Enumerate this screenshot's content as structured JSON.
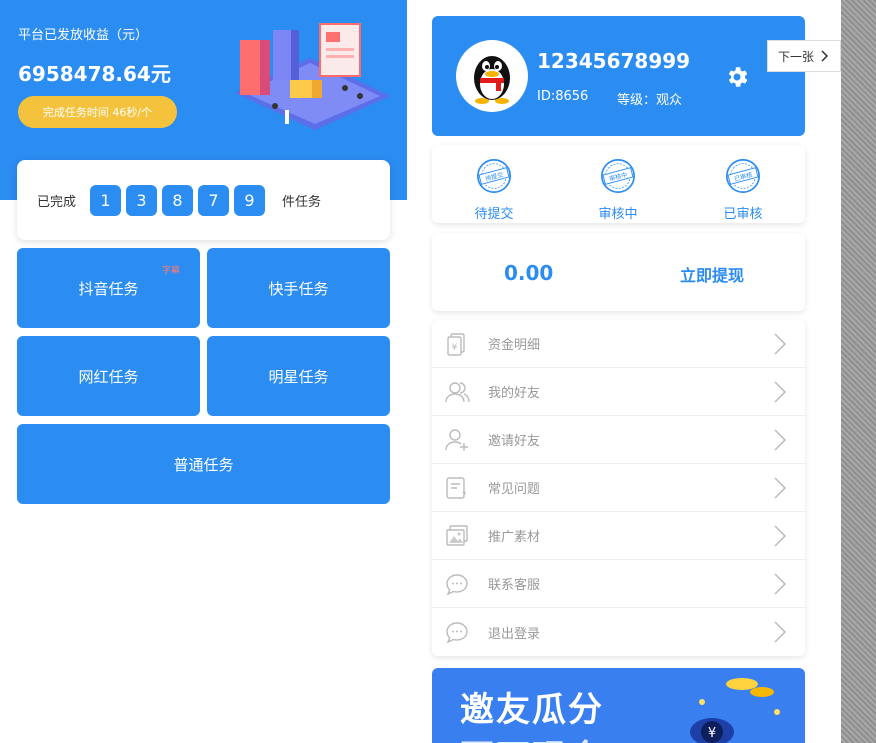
{
  "left": {
    "header_title": "平台已发放收益（元）",
    "amount": "6958478.64元",
    "pill": "完成任务时间 46秒/个",
    "done_prefix": "已完成",
    "done_digits": [
      "1",
      "3",
      "8",
      "7",
      "9"
    ],
    "done_suffix": "件任务",
    "tasks": {
      "douyin": "抖音任务",
      "douyin_badge": "字幕",
      "kuaishou": "快手任务",
      "wanghong": "网红任务",
      "mingxing": "明星任务",
      "putong": "普通任务"
    }
  },
  "right": {
    "phone": "12345678999",
    "id_label": "ID:8656",
    "level_label": "等级：观众",
    "next_label": "下一张",
    "status": {
      "pending_submit": "待提交",
      "pending_submit_stamp": "待提交",
      "reviewing": "审核中",
      "reviewing_stamp": "审核中",
      "reviewed": "已审核",
      "reviewed_stamp": "已审核"
    },
    "balance": "0.00",
    "withdraw": "立即提现",
    "menu": [
      {
        "label": "资金明细",
        "icon": "document-icon"
      },
      {
        "label": "我的好友",
        "icon": "friends-icon"
      },
      {
        "label": "邀请好友",
        "icon": "invite-user-icon"
      },
      {
        "label": "常见问题",
        "icon": "faq-icon"
      },
      {
        "label": "推广素材",
        "icon": "image-icon"
      },
      {
        "label": "联系客服",
        "icon": "chat-icon"
      },
      {
        "label": "退出登录",
        "icon": "logout-chat-icon"
      }
    ],
    "banner_line1": "邀友瓜分",
    "banner_line2": "百万现金",
    "banner_coin": "¥"
  },
  "colors": {
    "primary": "#2b8cf2",
    "pill": "#f4c23c",
    "menu_text": "#999999"
  }
}
